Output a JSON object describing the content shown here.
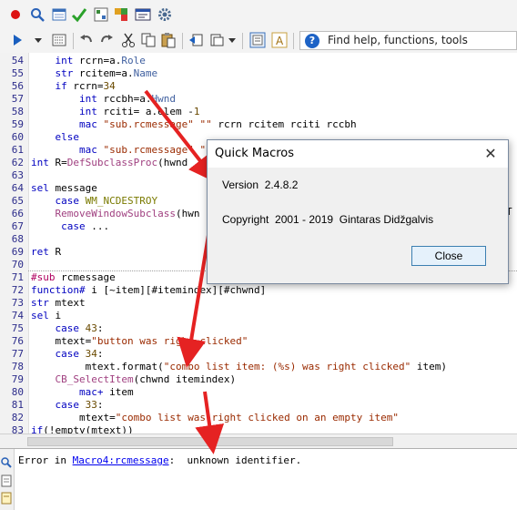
{
  "toolbar": {
    "help_placeholder": "Find help, functions, tools"
  },
  "editor": {
    "lines": [
      {
        "n": "54",
        "code": "    int rcrn=a.Role"
      },
      {
        "n": "55",
        "code": "    str rcitem=a.Name"
      },
      {
        "n": "56",
        "code": "    if rcrn=34"
      },
      {
        "n": "57",
        "code": "        int rccbh=a.Hwnd"
      },
      {
        "n": "58",
        "code": "        int rciti= a.elem -1"
      },
      {
        "n": "59",
        "code": "        mac \"sub.rcmessage\" \"\" rcrn rcitem rciti rccbh"
      },
      {
        "n": "60",
        "code": "    else"
      },
      {
        "n": "61",
        "code": "        mac \"sub.rcmessage\" \"\" rcrn rcitem"
      },
      {
        "n": "62",
        "code": "int R=DefSubclassProc(hwnd"
      },
      {
        "n": "63",
        "code": ""
      },
      {
        "n": "64",
        "code": "sel message"
      },
      {
        "n": "65",
        "code": "    case WM_NCDESTROY"
      },
      {
        "n": "66",
        "code": "    RemoveWindowSubclass(hwn"
      },
      {
        "n": "67",
        "code": "     case ..."
      },
      {
        "n": "68",
        "code": ""
      },
      {
        "n": "69",
        "code": "ret R"
      },
      {
        "n": "70",
        "code": ""
      },
      {
        "n": "71",
        "code": "#sub rcmessage"
      },
      {
        "n": "72",
        "code": "function# i [~item][#itemindex][#chwnd]"
      },
      {
        "n": "73",
        "code": "str mtext"
      },
      {
        "n": "74",
        "code": "sel i"
      },
      {
        "n": "75",
        "code": "    case 43:"
      },
      {
        "n": "76",
        "code": "    mtext=\"button was right clicked\""
      },
      {
        "n": "77",
        "code": "    case 34:"
      },
      {
        "n": "78",
        "code": "         mtext.format(\"combo list item: (%s) was right clicked\" item)"
      },
      {
        "n": "79",
        "code": "    CB_SelectItem(chwnd itemindex)"
      },
      {
        "n": "80",
        "code": "        mac+ item"
      },
      {
        "n": "81",
        "code": "    case 33:"
      },
      {
        "n": "82",
        "code": "        mtext=\"combo list was right clicked on an empty item\""
      },
      {
        "n": "83",
        "code": "if(!empty(mtext))"
      }
    ],
    "clipped_right": "T"
  },
  "output": {
    "prefix": "Error in ",
    "link": "Macro4:rcmessage",
    "suffix": ":  unknown identifier."
  },
  "dialog": {
    "title": "Quick Macros",
    "version": "Version  2.4.8.2",
    "copyright": "Copyright  2001 - 2019  Gintaras Didžgalvis",
    "close_label": "Close",
    "close_glyph": "✕"
  }
}
